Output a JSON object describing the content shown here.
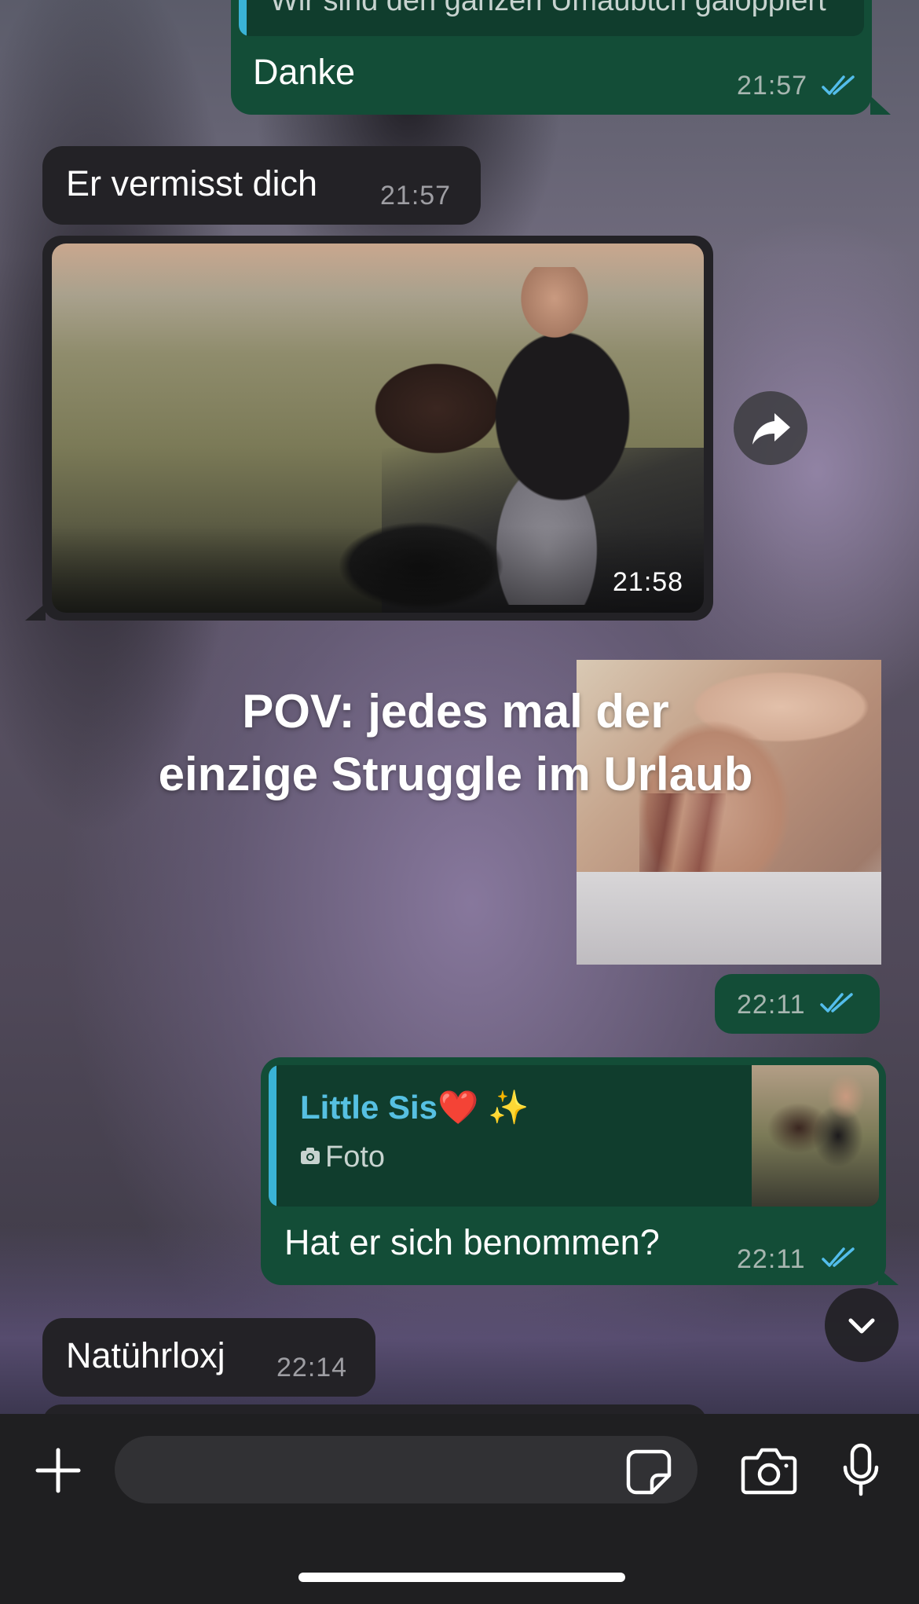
{
  "messages": [
    {
      "id": "m1",
      "direction": "out",
      "text": "Danke",
      "time": "21:57",
      "status": "read",
      "partial_quote_text": "Wir sind den ganzen Umaubtch galoppiert"
    },
    {
      "id": "m2",
      "direction": "in",
      "text": "Er vermisst dich",
      "time": "21:57"
    },
    {
      "id": "m3",
      "direction": "in",
      "type": "photo",
      "time": "21:58"
    },
    {
      "id": "m4",
      "direction": "out",
      "type": "photo",
      "time": "22:11",
      "status": "read"
    },
    {
      "id": "m5",
      "direction": "out",
      "text": "Hat er sich benommen?",
      "time": "22:11",
      "status": "read",
      "reply_to": {
        "name": "Little Sis❤️ ✨",
        "type_label": "Foto",
        "type_icon": "camera-icon"
      }
    },
    {
      "id": "m6",
      "direction": "in",
      "text": "Natührloxj",
      "time": "22:14"
    }
  ],
  "overlay_caption": {
    "line1": "POV: jedes mal der",
    "line2": "einzige Struggle im Urlaub"
  },
  "composer": {
    "input_value": "",
    "icons": [
      "plus-icon",
      "sticker-icon",
      "camera-icon",
      "microphone-icon"
    ]
  },
  "colors": {
    "outgoing_bubble": "#134d37",
    "incoming_bubble": "#232226",
    "read_ticks": "#53bdeb",
    "quote_name": "#56c0e2"
  }
}
